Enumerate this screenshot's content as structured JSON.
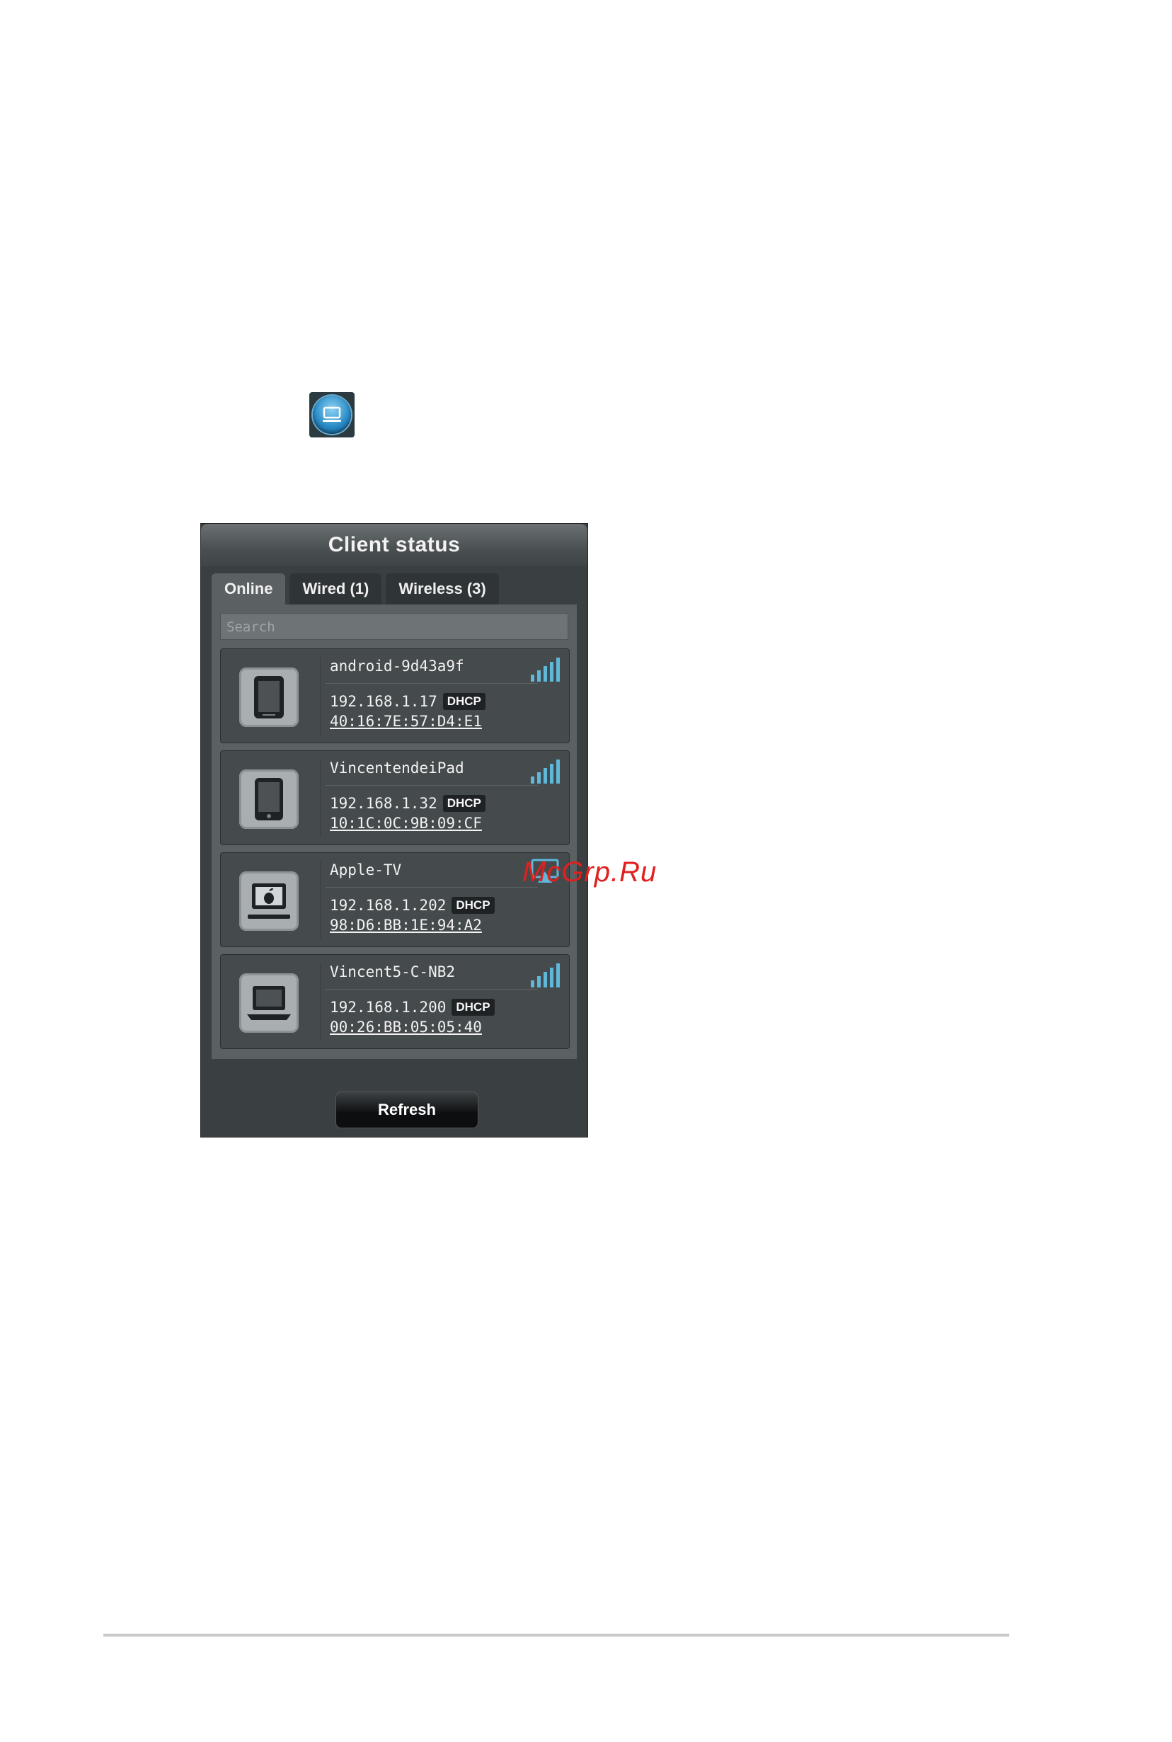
{
  "panel": {
    "title": "Client status",
    "tabs": [
      {
        "label": "Online",
        "active": true
      },
      {
        "label": "Wired (1)",
        "active": false
      },
      {
        "label": "Wireless (3)",
        "active": false
      }
    ],
    "search_placeholder": "Search",
    "clients": [
      {
        "name": "android-9d43a9f",
        "ip": "192.168.1.17",
        "badge": "DHCP",
        "mac": "40:16:7E:57:D4:E1",
        "device_icon": "tablet-icon",
        "status_icon": "wifi-signal-icon"
      },
      {
        "name": "VincentendeiPad",
        "ip": "192.168.1.32",
        "badge": "DHCP",
        "mac": "10:1C:0C:9B:09:CF",
        "device_icon": "ipad-icon",
        "status_icon": "wifi-signal-icon"
      },
      {
        "name": "Apple-TV",
        "ip": "192.168.1.202",
        "badge": "DHCP",
        "mac": "98:D6:BB:1E:94:A2",
        "device_icon": "apple-tv-icon",
        "status_icon": "airplay-icon"
      },
      {
        "name": "Vincent5-C-NB2",
        "ip": "192.168.1.200",
        "badge": "DHCP",
        "mac": "00:26:BB:05:05:40",
        "device_icon": "laptop-icon",
        "status_icon": "wifi-signal-icon"
      }
    ],
    "refresh_label": "Refresh"
  },
  "watermark": "McGrp.Ru",
  "colors": {
    "signal": "#5fb7d9",
    "panel_bg": "#3a3f42",
    "watermark": "#e0201e"
  }
}
